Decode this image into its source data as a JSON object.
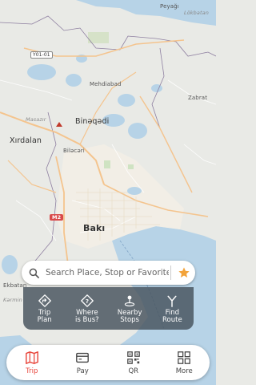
{
  "map": {
    "labels": {
      "peyagi": "Peyağı",
      "lokbatan_top": "Lökbatan",
      "y01": "Y01-01",
      "mehdiabad": "Mehdiabad",
      "zabrat": "Zabrat",
      "bineqedi": "Binəqədi",
      "masazir": "Masazır",
      "xirdalan": "Xırdalan",
      "bilacari": "Biləcəri",
      "m2": "M2",
      "baki": "Bakı",
      "ekbatan": "Ekbatan",
      "karmin": "Kərmin"
    },
    "colors": {
      "land": "#e9eae6",
      "water": "#b7d3e7",
      "urban": "#f2eee6",
      "major_road": "#f4c48e",
      "minor_road": "#ffffff",
      "boundary": "#8e7fa0"
    }
  },
  "search": {
    "placeholder": "Search Place, Stop or Favorite",
    "icon": "search-icon",
    "favorite_icon": "star-icon",
    "favorite_color": "#f2a33a"
  },
  "actions": [
    {
      "label": "Trip\nPlan",
      "icon": "trip-plan-icon"
    },
    {
      "label": "Where\nis Bus?",
      "icon": "where-is-bus-icon"
    },
    {
      "label": "Nearby\nStops",
      "icon": "nearby-stops-icon"
    },
    {
      "label": "Find\nRoute",
      "icon": "find-route-icon"
    }
  ],
  "tabs": [
    {
      "label": "Trip",
      "icon": "map-icon",
      "active": true
    },
    {
      "label": "Pay",
      "icon": "card-icon",
      "active": false
    },
    {
      "label": "QR",
      "icon": "qr-icon",
      "active": false
    },
    {
      "label": "More",
      "icon": "grid-icon",
      "active": false
    }
  ],
  "accent": "#e8463c"
}
